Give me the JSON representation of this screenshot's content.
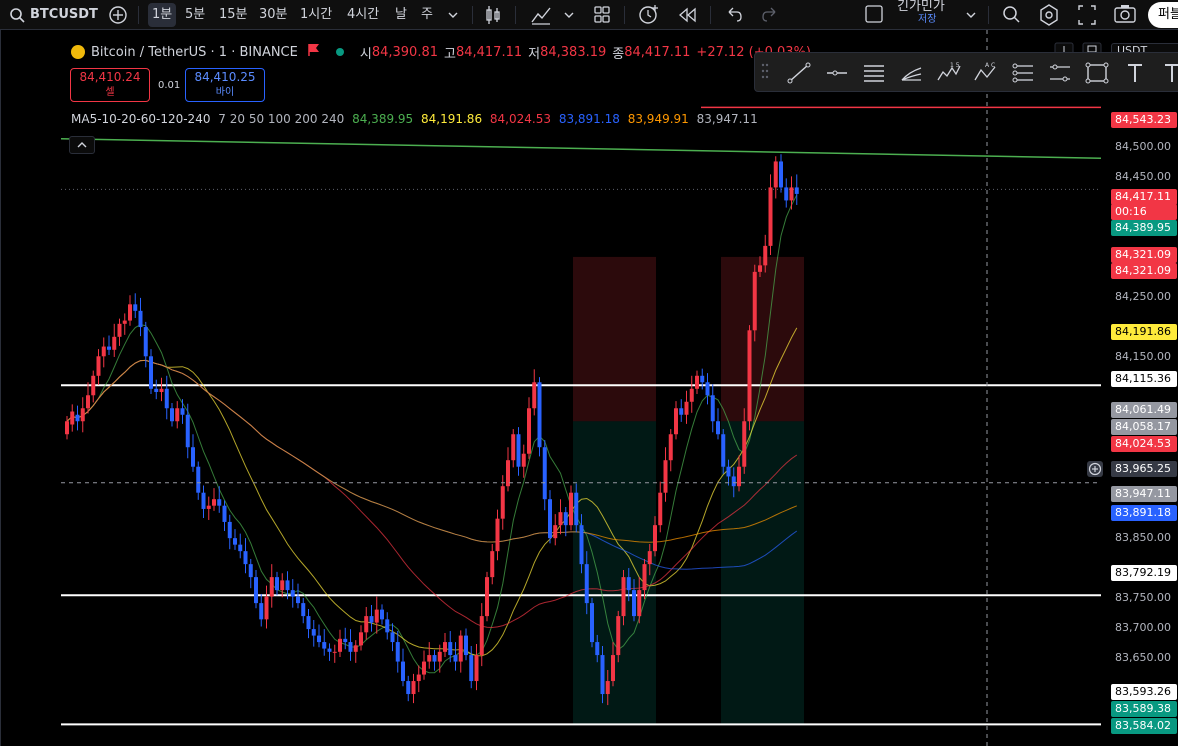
{
  "toolbar": {
    "symbol": "BTCUSDT",
    "intervals": [
      "1분",
      "5분",
      "15분",
      "30분",
      "1시간",
      "4시간",
      "날",
      "주"
    ],
    "active_interval": "1분",
    "layout_name": "긴가민가",
    "layout_status": "저장",
    "publish_label": "퍼블"
  },
  "legend": {
    "pair": "Bitcoin / TetherUS · 1 · BINANCE",
    "open_label": "시",
    "open": "84,390.81",
    "high_label": "고",
    "high": "84,417.11",
    "low_label": "저",
    "low": "84,383.19",
    "close_label": "종",
    "close": "84,417.11",
    "change": "+27.12 (+0.03%)"
  },
  "trade": {
    "sell_price": "84,410.24",
    "sell_label": "셀",
    "spread": "0.01",
    "buy_price": "84,410.25",
    "buy_label": "바이"
  },
  "ma": {
    "name": "MA5-10-20-60-120-240",
    "params": "7 20 50 100 200 240",
    "values": [
      {
        "text": "84,389.95",
        "color": "#4caf50"
      },
      {
        "text": "84,191.86",
        "color": "#ffeb3b"
      },
      {
        "text": "84,024.53",
        "color": "#f23645"
      },
      {
        "text": "83,891.18",
        "color": "#2962ff"
      },
      {
        "text": "83,949.91",
        "color": "#ff9800"
      },
      {
        "text": "83,947.11",
        "color": "#b2b5be"
      }
    ]
  },
  "currency": "USDT",
  "price_axis": {
    "ticks": [
      "84,500.00",
      "84,450.00",
      "84,250.00",
      "84,150.00",
      "83,850.00",
      "83,750.00",
      "83,700.00",
      "83,650.00"
    ],
    "tags": [
      {
        "text": "84,543.23",
        "bg": "#f23645",
        "fg": "#ffffff"
      },
      {
        "text": "84,417.11",
        "bg": "#f23645",
        "fg": "#ffffff"
      },
      {
        "text": "00:16",
        "bg": "#f23645",
        "fg": "#ffffff"
      },
      {
        "text": "84,389.95",
        "bg": "#089981",
        "fg": "#ffffff"
      },
      {
        "text": "84,321.09",
        "bg": "#f23645",
        "fg": "#ffffff"
      },
      {
        "text": "84,321.09",
        "bg": "#f23645",
        "fg": "#ffffff"
      },
      {
        "text": "84,191.86",
        "bg": "#ffeb3b",
        "fg": "#000000"
      },
      {
        "text": "84,115.36",
        "bg": "#ffffff",
        "fg": "#000000"
      },
      {
        "text": "84,061.49",
        "bg": "#9598a1",
        "fg": "#ffffff"
      },
      {
        "text": "84,058.17",
        "bg": "#9598a1",
        "fg": "#ffffff"
      },
      {
        "text": "84,024.53",
        "bg": "#f23645",
        "fg": "#ffffff"
      },
      {
        "text": "83,965.25",
        "bg": "#363a45",
        "fg": "#ffffff"
      },
      {
        "text": "83,947.11",
        "bg": "#9598a1",
        "fg": "#ffffff"
      },
      {
        "text": "83,891.18",
        "bg": "#2962ff",
        "fg": "#ffffff"
      },
      {
        "text": "83,792.19",
        "bg": "#ffffff",
        "fg": "#000000"
      },
      {
        "text": "83,593.26",
        "bg": "#ffffff",
        "fg": "#000000"
      },
      {
        "text": "83,589.38",
        "bg": "#089981",
        "fg": "#ffffff"
      },
      {
        "text": "83,584.02",
        "bg": "#089981",
        "fg": "#ffffff"
      }
    ]
  },
  "colors": {
    "up": "#f23645",
    "down": "#2962ff",
    "background": "#000000",
    "grid_line": "#ffffff",
    "trend_line": "#4caf50"
  },
  "chart_data": {
    "type": "candlestick",
    "price_range": [
      83560,
      84570
    ],
    "horizontal_levels": [
      84543.23,
      84115.36,
      83792.19,
      83593.26
    ],
    "crosshair_price": 83965.25,
    "trend_line": [
      84495,
      84465
    ],
    "positions": [
      {
        "entry": 84060,
        "stop": 84313,
        "target": 83593
      },
      {
        "entry": 84060,
        "stop": 84313,
        "target": 83593
      }
    ],
    "candles_open_close": [
      [
        84040,
        84060
      ],
      [
        84055,
        84075
      ],
      [
        84070,
        84060
      ],
      [
        84060,
        84080
      ],
      [
        84080,
        84100
      ],
      [
        84100,
        84130
      ],
      [
        84130,
        84160
      ],
      [
        84160,
        84175
      ],
      [
        84175,
        84170
      ],
      [
        84170,
        84190
      ],
      [
        84190,
        84210
      ],
      [
        84210,
        84215
      ],
      [
        84215,
        84240
      ],
      [
        84240,
        84230
      ],
      [
        84230,
        84205
      ],
      [
        84205,
        84160
      ],
      [
        84160,
        84110
      ],
      [
        84110,
        84105
      ],
      [
        84105,
        84110
      ],
      [
        84110,
        84080
      ],
      [
        84080,
        84060
      ],
      [
        84060,
        84080
      ],
      [
        84080,
        84070
      ],
      [
        84070,
        84020
      ],
      [
        84020,
        83990
      ],
      [
        83990,
        83950
      ],
      [
        83950,
        83925
      ],
      [
        83925,
        83930
      ],
      [
        83930,
        83940
      ],
      [
        83940,
        83930
      ],
      [
        83930,
        83905
      ],
      [
        83905,
        83880
      ],
      [
        83880,
        83870
      ],
      [
        83870,
        83860
      ],
      [
        83860,
        83840
      ],
      [
        83840,
        83820
      ],
      [
        83820,
        83780
      ],
      [
        83780,
        83755
      ],
      [
        83755,
        83790
      ],
      [
        83790,
        83820
      ],
      [
        83820,
        83800
      ],
      [
        83800,
        83815
      ],
      [
        83815,
        83800
      ],
      [
        83800,
        83790
      ],
      [
        83790,
        83780
      ],
      [
        83780,
        83760
      ],
      [
        83760,
        83740
      ],
      [
        83740,
        83730
      ],
      [
        83730,
        83720
      ],
      [
        83720,
        83710
      ],
      [
        83710,
        83705
      ],
      [
        83705,
        83705
      ],
      [
        83705,
        83725
      ],
      [
        83725,
        83720
      ],
      [
        83720,
        83705
      ],
      [
        83705,
        83715
      ],
      [
        83715,
        83735
      ],
      [
        83735,
        83760
      ],
      [
        83760,
        83750
      ],
      [
        83750,
        83770
      ],
      [
        83770,
        83755
      ],
      [
        83755,
        83735
      ],
      [
        83735,
        83720
      ],
      [
        83720,
        83690
      ],
      [
        83690,
        83660
      ],
      [
        83660,
        83640
      ],
      [
        83640,
        83660
      ],
      [
        83660,
        83670
      ],
      [
        83670,
        83690
      ],
      [
        83690,
        83700
      ],
      [
        83700,
        83690
      ],
      [
        83690,
        83705
      ],
      [
        83705,
        83720
      ],
      [
        83720,
        83700
      ],
      [
        83700,
        83690
      ],
      [
        83690,
        83730
      ],
      [
        83730,
        83700
      ],
      [
        83700,
        83660
      ],
      [
        83660,
        83700
      ],
      [
        83700,
        83760
      ],
      [
        83760,
        83820
      ],
      [
        83820,
        83860
      ],
      [
        83860,
        83910
      ],
      [
        83910,
        83960
      ],
      [
        83960,
        84000
      ],
      [
        84000,
        84040
      ],
      [
        84040,
        83990
      ],
      [
        83990,
        84010
      ],
      [
        84010,
        84080
      ],
      [
        84080,
        84120
      ],
      [
        84120,
        84020
      ],
      [
        84020,
        83940
      ],
      [
        83940,
        83880
      ],
      [
        83880,
        83900
      ],
      [
        83900,
        83920
      ],
      [
        83920,
        83900
      ],
      [
        83900,
        83950
      ],
      [
        83950,
        83900
      ],
      [
        83900,
        83840
      ],
      [
        83840,
        83780
      ],
      [
        83780,
        83720
      ],
      [
        83720,
        83700
      ],
      [
        83700,
        83640
      ],
      [
        83640,
        83660
      ],
      [
        83660,
        83700
      ],
      [
        83700,
        83760
      ],
      [
        83760,
        83820
      ],
      [
        83820,
        83800
      ],
      [
        83800,
        83760
      ],
      [
        83760,
        83800
      ],
      [
        83800,
        83840
      ],
      [
        83840,
        83860
      ],
      [
        83860,
        83900
      ],
      [
        83900,
        83950
      ],
      [
        83950,
        84000
      ],
      [
        84000,
        84040
      ],
      [
        84040,
        84080
      ],
      [
        84080,
        84070
      ],
      [
        84070,
        84090
      ],
      [
        84090,
        84110
      ],
      [
        84110,
        84130
      ],
      [
        84130,
        84120
      ],
      [
        84120,
        84100
      ],
      [
        84100,
        84060
      ],
      [
        84060,
        84040
      ],
      [
        84040,
        83990
      ],
      [
        83990,
        83975
      ],
      [
        83975,
        83960
      ],
      [
        83960,
        83990
      ],
      [
        83990,
        84060
      ],
      [
        84060,
        84200
      ],
      [
        84200,
        84290
      ],
      [
        84290,
        84300
      ],
      [
        84300,
        84330
      ],
      [
        84330,
        84420
      ],
      [
        84420,
        84460
      ],
      [
        84460,
        84420
      ],
      [
        84420,
        84400
      ],
      [
        84400,
        84420
      ],
      [
        84420,
        84410
      ]
    ]
  }
}
